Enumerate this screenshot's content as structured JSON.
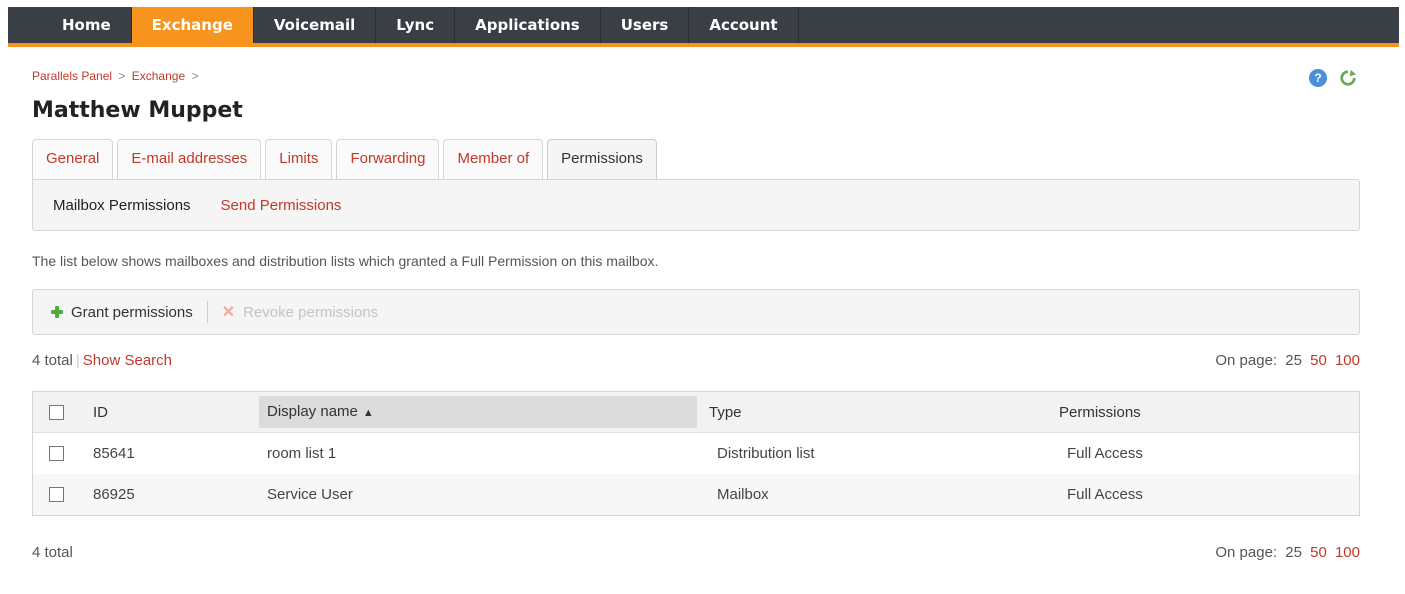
{
  "nav": {
    "items": [
      {
        "label": "Home",
        "active": false
      },
      {
        "label": "Exchange",
        "active": true
      },
      {
        "label": "Voicemail",
        "active": false
      },
      {
        "label": "Lync",
        "active": false
      },
      {
        "label": "Applications",
        "active": false
      },
      {
        "label": "Users",
        "active": false
      },
      {
        "label": "Account",
        "active": false
      }
    ]
  },
  "breadcrumb": {
    "items": [
      "Parallels Panel",
      "Exchange"
    ],
    "separator": ">"
  },
  "header": {
    "title": "Matthew Muppet",
    "help_icon": "help-icon",
    "refresh_icon": "refresh-icon"
  },
  "tabs": [
    {
      "label": "General",
      "active": false
    },
    {
      "label": "E-mail addresses",
      "active": false
    },
    {
      "label": "Limits",
      "active": false
    },
    {
      "label": "Forwarding",
      "active": false
    },
    {
      "label": "Member of",
      "active": false
    },
    {
      "label": "Permissions",
      "active": true
    }
  ],
  "subtabs": [
    {
      "label": "Mailbox Permissions",
      "current": true
    },
    {
      "label": "Send Permissions",
      "current": false
    }
  ],
  "description": "The list below shows mailboxes and distribution lists which granted a Full Permission on this mailbox.",
  "toolbar": {
    "grant_label": "Grant permissions",
    "revoke_label": "Revoke permissions"
  },
  "summary": {
    "total": "4 total",
    "show_search": "Show Search",
    "on_page_label": "On page:",
    "page_sizes": [
      "25",
      "50",
      "100"
    ]
  },
  "table": {
    "columns": [
      "ID",
      "Display name",
      "Type",
      "Permissions"
    ],
    "sorted_column": "Display name",
    "sort_direction": "ascending",
    "rows": [
      {
        "id": "85641",
        "name": "room list 1",
        "type": "Distribution list",
        "permissions": "Full Access"
      },
      {
        "id": "86925",
        "name": "Service User",
        "type": "Mailbox",
        "permissions": "Full Access"
      }
    ]
  },
  "colors": {
    "accent": "#f7941d",
    "nav_bg": "#3a3e45",
    "link": "#c0392b"
  }
}
